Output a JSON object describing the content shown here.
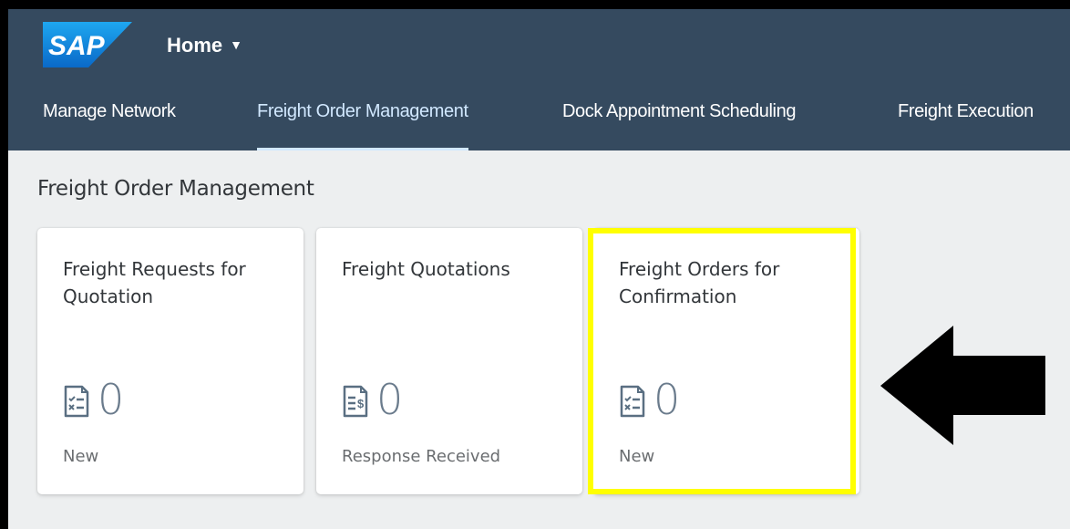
{
  "shell": {
    "logo_text": "SAP",
    "home_label": "Home",
    "home_caret": "▼"
  },
  "nav": {
    "tabs": [
      {
        "label": "Manage Network",
        "active": false
      },
      {
        "label": "Freight Order Management",
        "active": true
      },
      {
        "label": "Dock Appointment Scheduling",
        "active": false
      },
      {
        "label": "Freight Execution",
        "active": false
      }
    ]
  },
  "section": {
    "title": "Freight Order Management"
  },
  "tiles": [
    {
      "title": "Freight Requests for Quotation",
      "value": "0",
      "footer": "New",
      "icon": "document-checklist-icon"
    },
    {
      "title": "Freight Quotations",
      "value": "0",
      "footer": "Response Received",
      "icon": "document-price-icon"
    },
    {
      "title": "Freight Orders for Confirmation",
      "value": "0",
      "footer": "New",
      "icon": "document-checklist-icon",
      "highlighted": true
    }
  ],
  "annotation": {
    "highlight_color": "#ffff00",
    "arrow_color": "#000000",
    "arrow_icon": "left-arrow-icon"
  },
  "colors": {
    "shell_bg": "#354a5f",
    "page_bg": "#edeff0",
    "active_tab": "#d1e8ff"
  }
}
